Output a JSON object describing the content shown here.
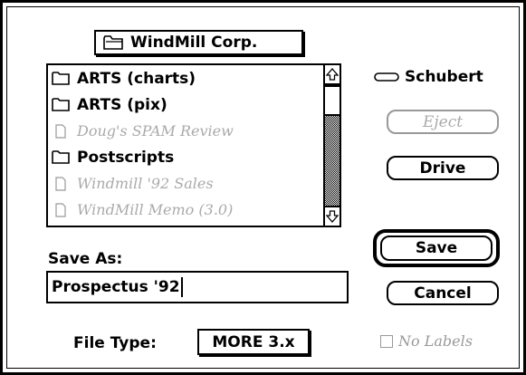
{
  "folder_popup": {
    "label": "WindMill Corp.",
    "icon": "folder-icon"
  },
  "file_list": {
    "items": [
      {
        "name": "ARTS (charts)",
        "kind": "folder",
        "enabled": true
      },
      {
        "name": "ARTS (pix)",
        "kind": "folder",
        "enabled": true
      },
      {
        "name": "Doug's SPAM Review",
        "kind": "document",
        "enabled": false
      },
      {
        "name": "Postscripts",
        "kind": "folder",
        "enabled": true
      },
      {
        "name": "Windmill '92 Sales",
        "kind": "document",
        "enabled": false
      },
      {
        "name": "WindMill Memo (3.0)",
        "kind": "document",
        "enabled": false
      }
    ]
  },
  "volume": {
    "label": "Schubert",
    "icon": "disk-icon"
  },
  "buttons": {
    "eject": "Eject",
    "drive": "Drive",
    "save": "Save",
    "cancel": "Cancel"
  },
  "save_as": {
    "label": "Save As:",
    "value": "Prospectus '92"
  },
  "file_type": {
    "label": "File Type:",
    "value": "MORE 3.x"
  },
  "no_labels": {
    "label": "No Labels",
    "checked": false,
    "enabled": false
  }
}
